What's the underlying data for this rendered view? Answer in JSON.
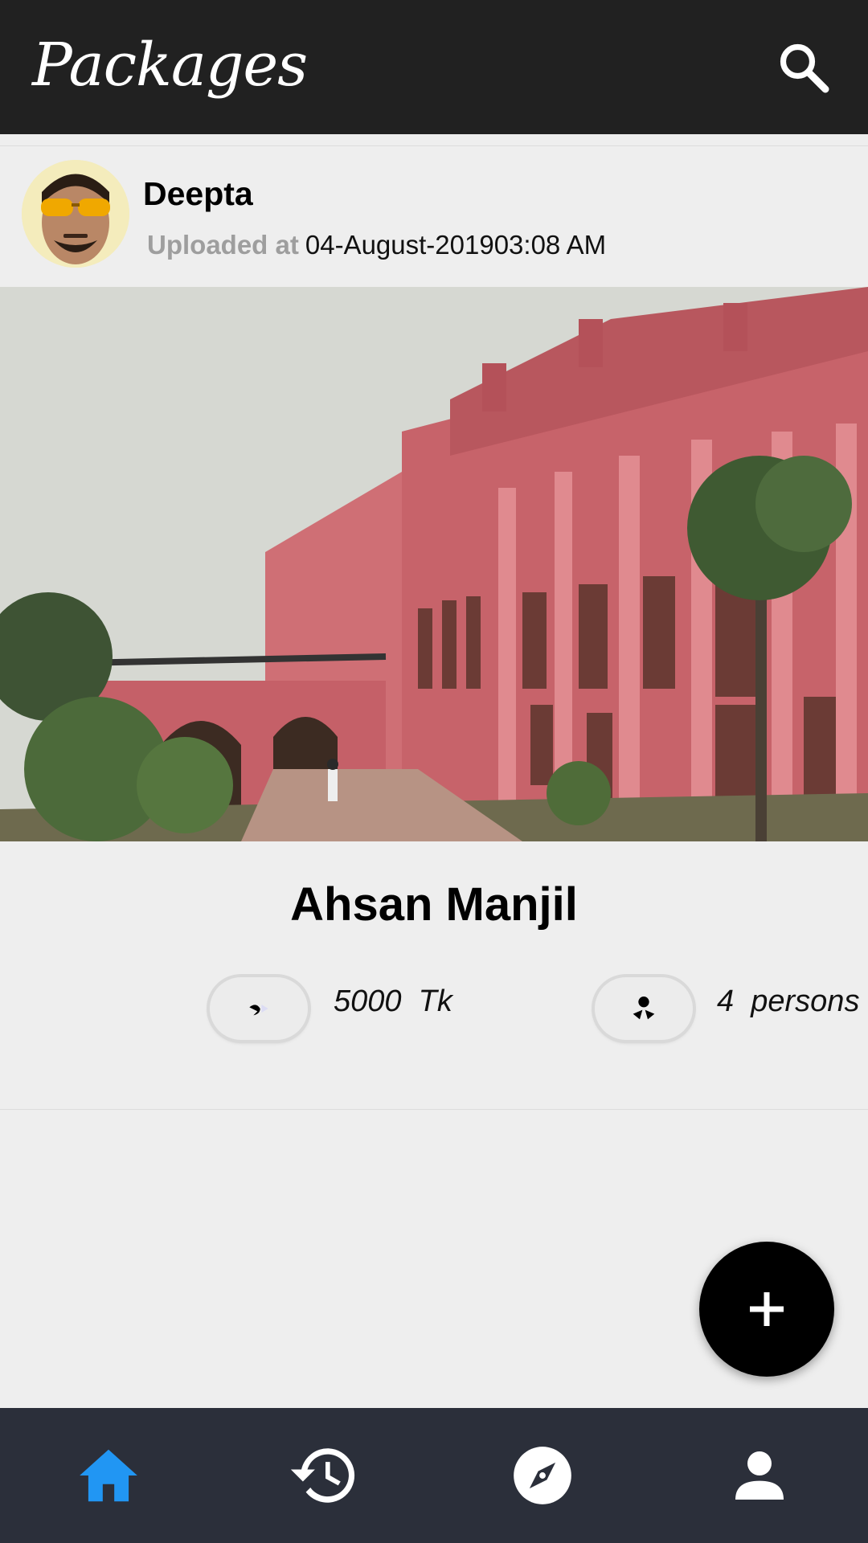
{
  "appbar": {
    "title": "Packages",
    "search_icon": "search-icon"
  },
  "post": {
    "user": "Deepta",
    "uploaded_label": "Uploaded at",
    "uploaded_value": "04-August-201903:08 AM",
    "title": "Ahsan Manjil",
    "price": "5000  Tk",
    "persons": "4  persons"
  },
  "fab": {
    "icon": "add-icon"
  },
  "bottom_nav": {
    "items": [
      {
        "icon": "home-icon",
        "active": true
      },
      {
        "icon": "history-icon",
        "active": false
      },
      {
        "icon": "compass-icon",
        "active": false
      },
      {
        "icon": "person-icon",
        "active": false
      }
    ],
    "active_color": "#2196f3",
    "inactive_color": "#ffffff"
  },
  "colors": {
    "appbar": "#212121",
    "bottom_nav": "#2b2f3a",
    "background": "#eeeeee"
  }
}
